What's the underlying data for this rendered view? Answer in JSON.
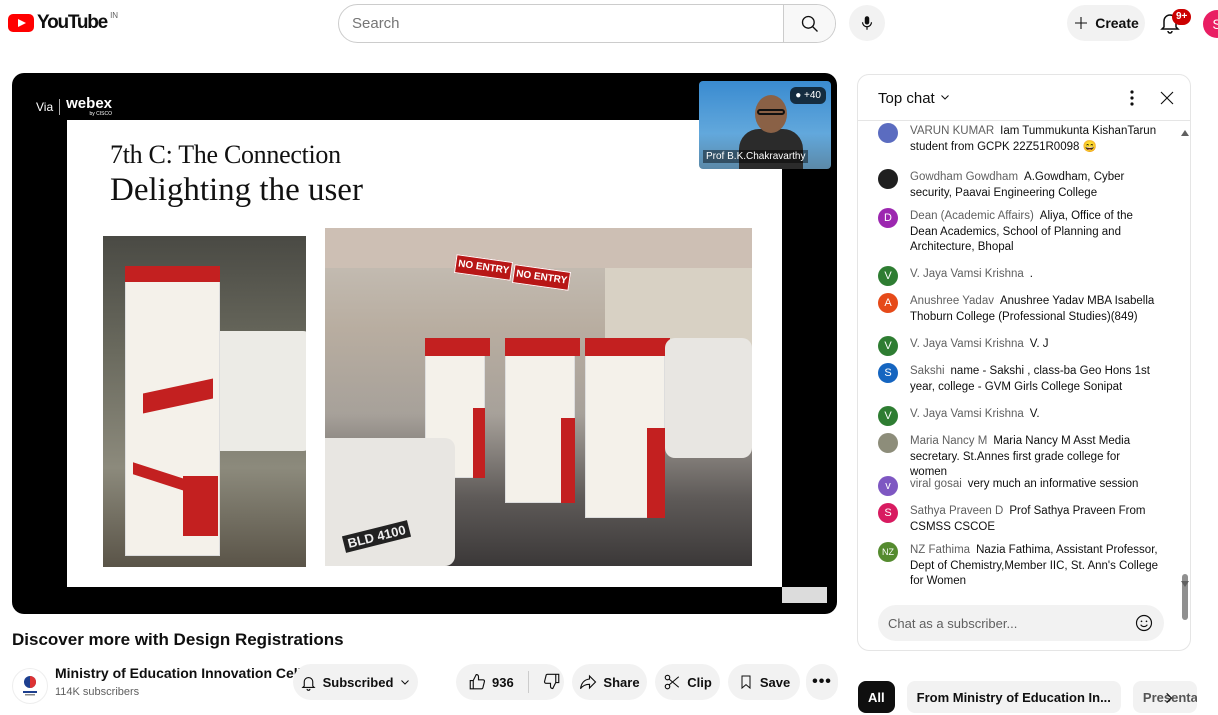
{
  "header": {
    "logo_text": "YouTube",
    "country_code": "IN",
    "search_placeholder": "Search",
    "create_label": "Create",
    "notification_count": "9+",
    "avatar_letter": "S"
  },
  "player": {
    "via_label": "Via",
    "brand_label": "webex",
    "brand_sub": "by CISCO",
    "participant_count": "+40",
    "speaker_name": "Prof B.K.Chakravarthy",
    "slide_heading": "7th C: The Connection",
    "slide_title": "Delighting the user",
    "sign_1": "NO ENTRY",
    "sign_2": "NO ENTRY",
    "plate_text": "BLD 4100"
  },
  "video": {
    "title": "Discover more with Design Registrations",
    "channel_name": "Ministry of Education Innovation Cell",
    "subscriber_count": "114K subscribers",
    "subscribed_label": "Subscribed",
    "like_count": "936",
    "share_label": "Share",
    "clip_label": "Clip",
    "save_label": "Save"
  },
  "chat": {
    "mode_label": "Top chat",
    "input_placeholder": "Chat as a subscriber...",
    "messages": [
      {
        "author": "VARUN KUMAR",
        "text": "Iam Tummukunta KishanTarun student from GCPK 22Z51R0098 😄",
        "avatar": "",
        "color": "#5b6cc0"
      },
      {
        "author": "Gowdham Gowdham",
        "text": "A.Gowdham, Cyber security, Paavai Engineering College",
        "avatar": "",
        "color": "#1f1f1f"
      },
      {
        "author": "Dean (Academic Affairs)",
        "text": "Aliya, Office of the Dean Academics, School of Planning and Architecture, Bhopal",
        "avatar": "D",
        "color": "#9c27b0"
      },
      {
        "author": "V. Jaya Vamsi Krishna",
        "text": ".",
        "avatar": "V",
        "color": "#2e7d32"
      },
      {
        "author": "Anushree Yadav",
        "text": "Anushree Yadav MBA Isabella Thoburn College (Professional Studies)(849)",
        "avatar": "A",
        "color": "#e64a19"
      },
      {
        "author": "V. Jaya Vamsi Krishna",
        "text": "V. J",
        "avatar": "V",
        "color": "#2e7d32"
      },
      {
        "author": "Sakshi",
        "text": "name - Sakshi , class-ba Geo Hons 1st year, college - GVM Girls College Sonipat",
        "avatar": "S",
        "color": "#1565c0"
      },
      {
        "author": "V. Jaya Vamsi Krishna",
        "text": "V.",
        "avatar": "V",
        "color": "#2e7d32"
      },
      {
        "author": "Maria Nancy M",
        "text": "Maria Nancy M Asst Media secretary. St.Annes first grade college for women",
        "avatar": "",
        "color": "#8d8d7a"
      },
      {
        "author": "viral gosai",
        "text": "very much an informative session",
        "avatar": "v",
        "color": "#7e57c2"
      },
      {
        "author": "Sathya Praveen D",
        "text": "Prof Sathya Praveen From CSMSS CSCOE",
        "avatar": "S",
        "color": "#d81b60"
      },
      {
        "author": "NZ Fathima",
        "text": "Nazia Fathima, Assistant Professor, Dept of Chemistry,Member IIC, St. Ann's College for Women",
        "avatar": "NZ",
        "color": "#558b2f"
      }
    ]
  },
  "chips": [
    "All",
    "From Ministry of Education In...",
    "Presenta"
  ]
}
